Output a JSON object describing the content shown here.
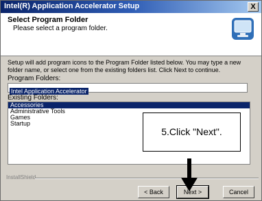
{
  "window": {
    "title": "Intel(R) Application Accelerator Setup",
    "close_label": "X"
  },
  "header": {
    "title": "Select Program Folder",
    "subtitle": "Please select a program folder.",
    "icon": "installer-monitor-icon"
  },
  "description": "Setup will add program icons to the Program Folder listed below. You may type a new folder name, or select one from the existing folders list. Click Next to continue.",
  "program_folder": {
    "label": "Program Folders:",
    "value": "Intel Application Accelerator"
  },
  "existing_folders": {
    "label": "Existing Folders:",
    "items": [
      {
        "label": "Accessories",
        "selected": true
      },
      {
        "label": "Administrative Tools",
        "selected": false
      },
      {
        "label": "Games",
        "selected": false
      },
      {
        "label": "Startup",
        "selected": false
      }
    ]
  },
  "callout": {
    "text": "5.Click  \"Next\"."
  },
  "footer": {
    "brand_label": "InstallShield",
    "back_label": "< Back",
    "next_label": "Next >",
    "cancel_label": "Cancel"
  },
  "colors": {
    "title_bar_start": "#0a246a",
    "title_bar_end": "#a6caf0",
    "selection": "#0a246a",
    "dialog_face": "#d4d0c8"
  }
}
